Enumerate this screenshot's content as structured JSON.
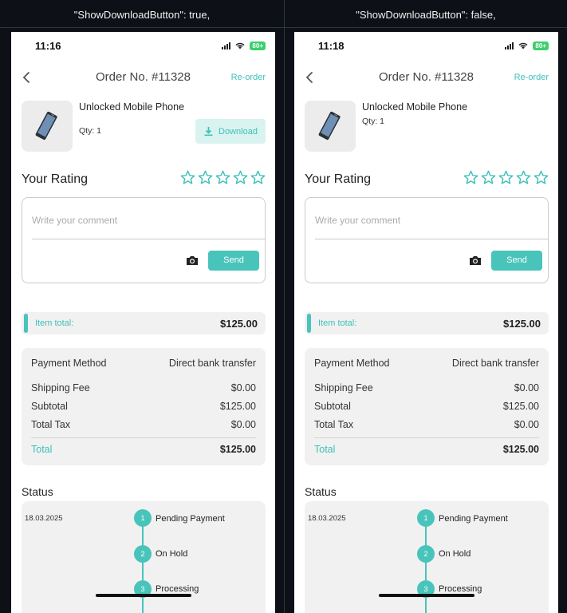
{
  "headers": {
    "left": "\"ShowDownloadButton\": true,",
    "right": "\"ShowDownloadButton\": false,"
  },
  "screens": {
    "left": {
      "time": "11:16",
      "battery": "80+",
      "title": "Order No. #11328",
      "reorder": "Re-order",
      "product_name": "Unlocked Mobile Phone",
      "qty": "Qty: 1",
      "download_label": "Download",
      "rating_title": "Your Rating",
      "comment_placeholder": "Write your comment",
      "send_label": "Send",
      "item_total_label": "Item total:",
      "item_total_value": "$125.00",
      "payment_label": "Payment Method",
      "payment_value": "Direct bank transfer",
      "shipping_label": "Shipping Fee",
      "shipping_value": "$0.00",
      "subtotal_label": "Subtotal",
      "subtotal_value": "$125.00",
      "tax_label": "Total Tax",
      "tax_value": "$0.00",
      "total_label": "Total",
      "total_value": "$125.00",
      "status_title": "Status",
      "date": "18.03.2025",
      "steps": [
        {
          "num": "1",
          "label": "Pending Payment"
        },
        {
          "num": "2",
          "label": "On Hold"
        },
        {
          "num": "3",
          "label": "Processing"
        }
      ]
    },
    "right": {
      "time": "11:18",
      "battery": "80+",
      "title": "Order No. #11328",
      "reorder": "Re-order",
      "product_name": "Unlocked Mobile Phone",
      "qty": "Qty: 1",
      "rating_title": "Your Rating",
      "comment_placeholder": "Write your comment",
      "send_label": "Send",
      "item_total_label": "Item total:",
      "item_total_value": "$125.00",
      "payment_label": "Payment Method",
      "payment_value": "Direct bank transfer",
      "shipping_label": "Shipping Fee",
      "shipping_value": "$0.00",
      "subtotal_label": "Subtotal",
      "subtotal_value": "$125.00",
      "tax_label": "Total Tax",
      "tax_value": "$0.00",
      "total_label": "Total",
      "total_value": "$125.00",
      "status_title": "Status",
      "date": "18.03.2025",
      "steps": [
        {
          "num": "1",
          "label": "Pending Payment"
        },
        {
          "num": "2",
          "label": "On Hold"
        },
        {
          "num": "3",
          "label": "Processing"
        }
      ]
    }
  },
  "colors": {
    "accent": "#48c4bb",
    "download_bg": "#d9f3f1",
    "card_bg": "#f1f1f1",
    "battery": "#3ecf6e"
  },
  "icons": [
    "back-arrow-icon",
    "signal-icon",
    "wifi-icon",
    "battery-icon",
    "phone-product-image",
    "download-icon",
    "star-outline-icon",
    "camera-icon"
  ]
}
